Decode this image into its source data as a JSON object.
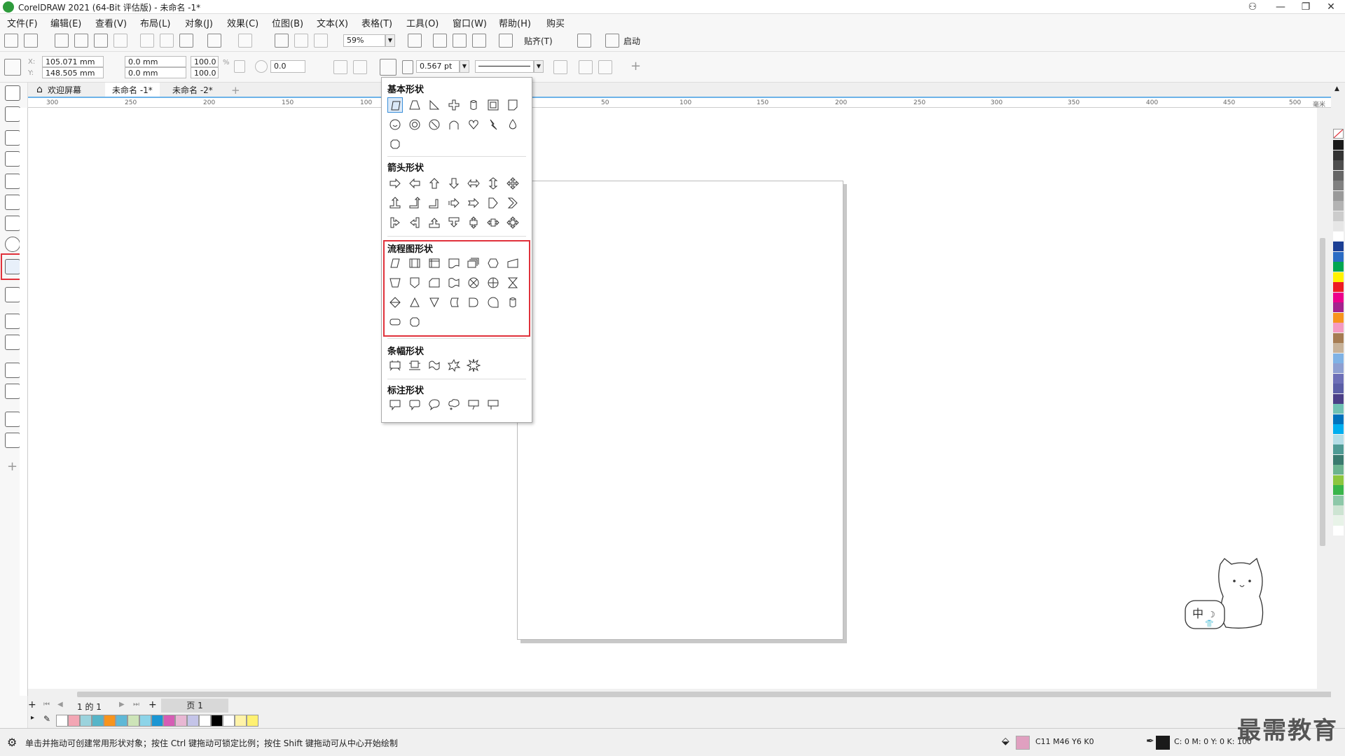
{
  "app": {
    "title": "CorelDRAW 2021 (64-Bit 评估版) - 未命名 -1*"
  },
  "menu": [
    "文件(F)",
    "编辑(E)",
    "查看(V)",
    "布局(L)",
    "对象(J)",
    "效果(C)",
    "位图(B)",
    "文本(X)",
    "表格(T)",
    "工具(O)",
    "窗口(W)",
    "帮助(H)",
    "购买"
  ],
  "toolbar": {
    "zoom": "59%",
    "snap_label": "贴齐(T)",
    "launch_label": "启动"
  },
  "props": {
    "x": "105.071 mm",
    "y": "148.505 mm",
    "w": "0.0 mm",
    "h": "0.0 mm",
    "sx": "100.0",
    "sy": "100.0",
    "pct": "%",
    "angle": "0.0",
    "outline": "0.567 pt",
    "x_lbl": "X:",
    "y_lbl": "Y:"
  },
  "tabs": {
    "home": "欢迎屏幕",
    "doc1": "未命名 -1*",
    "doc2": "未命名 -2*"
  },
  "ruler": {
    "ticks": [
      "300",
      "250",
      "200",
      "150",
      "100",
      "50",
      "100",
      "150",
      "200",
      "250",
      "300",
      "350",
      "400",
      "450",
      "500"
    ],
    "unit": "毫米"
  },
  "flyout": {
    "basic": "基本形状",
    "arrow": "箭头形状",
    "flow": "流程图形状",
    "banner": "条幅形状",
    "callout": "标注形状"
  },
  "pagenav": {
    "counter": "1 的 1",
    "page_tab": "页 1"
  },
  "status": {
    "hint": "单击并拖动可创建常用形状对象；按住 Ctrl 键拖动可锁定比例；按住 Shift 键拖动可从中心开始绘制",
    "fill": "C11 M46 Y6 K0",
    "outline": "C: 0 M: 0 Y: 0 K: 100"
  },
  "watermark": "最需教育",
  "mascot_label": "中",
  "colors": {
    "accent": "#e0313b",
    "fill_swatch": "#e0a0c0",
    "palette": [
      "#1a1a1a",
      "#333333",
      "#4d4d4d",
      "#666666",
      "#808080",
      "#999999",
      "#b3b3b3",
      "#cccccc",
      "#e6e6e6",
      "#ffffff",
      "#1c3f94",
      "#2b6cc4",
      "#00a651",
      "#fff200",
      "#ed1c24",
      "#ec008c",
      "#a3238e",
      "#f7941d",
      "#f49ac1",
      "#a67c52",
      "#c7b299",
      "#7fb2e5",
      "#8e9fd1",
      "#6d6fb7",
      "#5b5ea6",
      "#4b3f87",
      "#70c1b3",
      "#0072bc",
      "#00aeef",
      "#b4dde6",
      "#4f9a94",
      "#3a7a6e",
      "#6cb38f",
      "#8dc63f",
      "#39b54a",
      "#8dc8a8",
      "#cde4d2",
      "#e8f3e8",
      "#ffffff"
    ],
    "doc_swatches": [
      "#ffffff",
      "#f3a6b4",
      "#9bd3dd",
      "#56b5c8",
      "#f7941d",
      "#5fb8d6",
      "#cde4b8",
      "#8dd4e8",
      "#1b96d3",
      "#d65db5",
      "#e8b7d3",
      "#c4c4e8",
      "#ffffff",
      "#000000",
      "#ffffff",
      "#fff3a8",
      "#fff172"
    ]
  }
}
